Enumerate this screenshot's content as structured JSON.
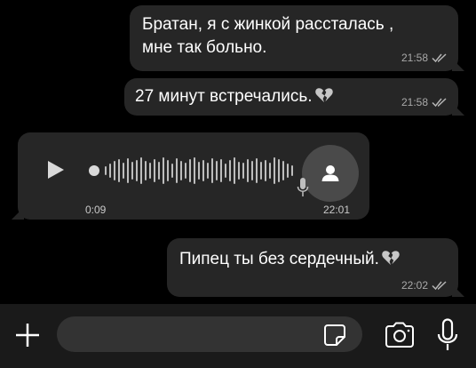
{
  "messages": [
    {
      "id": "msg1",
      "direction": "outgoing",
      "lines": [
        "Братан, я с жинкой рассталась ,",
        "мне так больно."
      ],
      "time": "21:58",
      "status": "read"
    },
    {
      "id": "msg2",
      "direction": "outgoing",
      "text": "27 минут встречались.",
      "emoji": "broken-heart",
      "time": "21:58",
      "status": "read"
    },
    {
      "id": "voice1",
      "direction": "incoming",
      "type": "voice",
      "duration": "0:09",
      "time": "22:01",
      "playback_progress": 0
    },
    {
      "id": "msg3",
      "direction": "outgoing",
      "text": "Пипец ты без сердечный.",
      "emoji": "broken-heart",
      "time": "22:02",
      "status": "read"
    }
  ],
  "composer": {
    "placeholder": "",
    "value": ""
  },
  "colors": {
    "background": "#000000",
    "bubble": "#262626",
    "input_bar": "#1a1a1a",
    "meta_text": "#a9a9a9",
    "avatar_bg": "#4a4a4a"
  },
  "icons": [
    "plus-icon",
    "sticker-icon",
    "camera-icon",
    "microphone-icon",
    "play-icon",
    "person-icon",
    "double-check-icon",
    "broken-heart-icon"
  ]
}
